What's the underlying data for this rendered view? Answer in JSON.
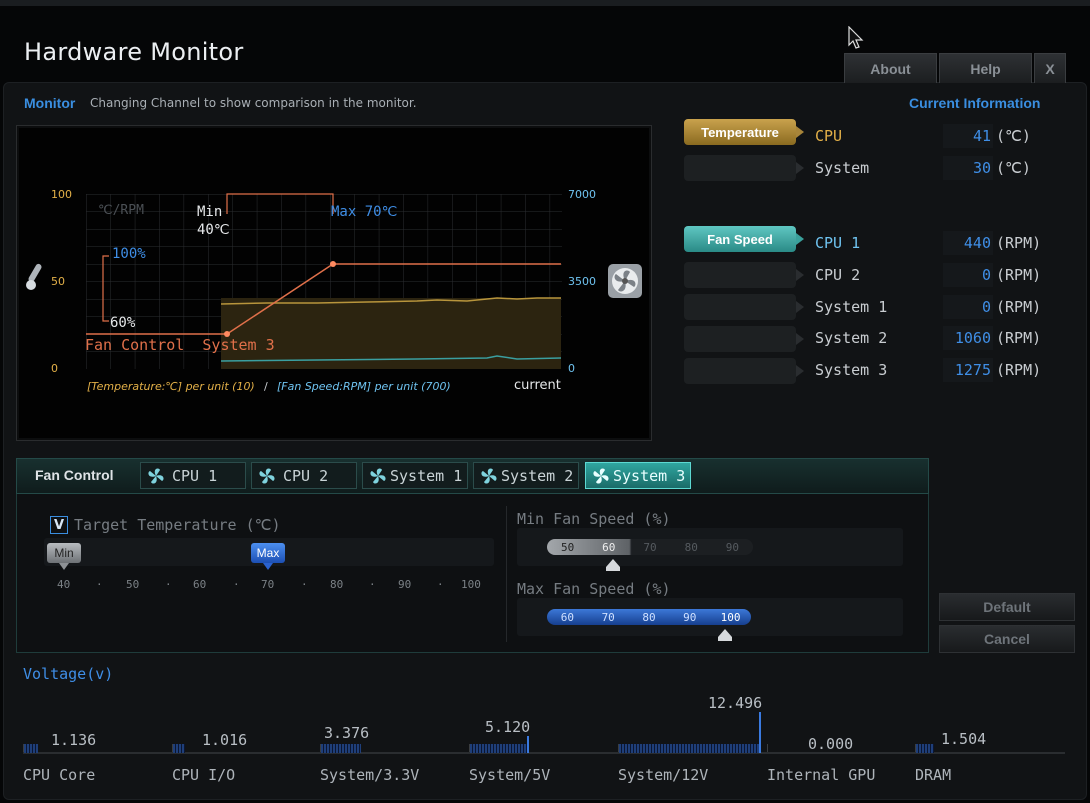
{
  "app": {
    "title": "Hardware Monitor",
    "buttons": {
      "about": "About",
      "help": "Help",
      "close": "X"
    }
  },
  "monitor": {
    "title": "Monitor",
    "description": "Changing Channel to show comparison in the monitor.",
    "current_info_title": "Current Information",
    "graph": {
      "left_axis": [
        "100",
        "50",
        "0"
      ],
      "right_axis": [
        "7000",
        "3500",
        "0"
      ],
      "unit_label": "℃/RPM",
      "min_label": "Min",
      "min_temp": "40℃",
      "max_label": "Max 70℃",
      "pct_high": "100%",
      "pct_low": "60%",
      "channel_label": "Fan Control  System 3",
      "legend_temp": "[Temperature:℃] per unit (10)",
      "legend_sep": "/",
      "legend_fan": "[Fan Speed:RPM] per unit (700)",
      "current_label": "current"
    }
  },
  "current_info": {
    "temperature_tab": "Temperature",
    "fan_speed_tab": "Fan Speed",
    "temperatures": [
      {
        "name": "CPU",
        "value": "41",
        "unit": "(℃)"
      },
      {
        "name": "System",
        "value": "30",
        "unit": "(℃)"
      }
    ],
    "fans": [
      {
        "name": "CPU 1",
        "value": "440",
        "unit": "(RPM)"
      },
      {
        "name": "CPU 2",
        "value": "0",
        "unit": "(RPM)"
      },
      {
        "name": "System 1",
        "value": "0",
        "unit": "(RPM)"
      },
      {
        "name": "System 2",
        "value": "1060",
        "unit": "(RPM)"
      },
      {
        "name": "System 3",
        "value": "1275",
        "unit": "(RPM)"
      }
    ]
  },
  "fan_control": {
    "label": "Fan Control",
    "tabs": [
      "CPU 1",
      "CPU 2",
      "System 1",
      "System 2",
      "System 3"
    ],
    "active_tab": "System 3",
    "target_checkbox": "V",
    "target_label": "Target Temperature (℃)",
    "min_thumb": "Min",
    "max_thumb": "Max",
    "target_ticks": [
      "40",
      "·",
      "50",
      "·",
      "60",
      "·",
      "70",
      "·",
      "80",
      "·",
      "90",
      "·",
      "100"
    ],
    "target_min_value": 40,
    "target_max_value": 70,
    "min_fan_label": "Min Fan Speed (%)",
    "min_fan_options": [
      "50",
      "60",
      "70",
      "80",
      "90"
    ],
    "min_fan_value": "60",
    "max_fan_label": "Max Fan Speed (%)",
    "max_fan_options": [
      "60",
      "70",
      "80",
      "90",
      "100"
    ],
    "max_fan_value": "100",
    "default_button": "Default",
    "cancel_button": "Cancel"
  },
  "voltage": {
    "title": "Voltage(v)",
    "items": [
      {
        "label": "CPU Core",
        "value": "1.136"
      },
      {
        "label": "CPU I/O",
        "value": "1.016"
      },
      {
        "label": "System/3.3V",
        "value": "3.376"
      },
      {
        "label": "System/5V",
        "value": "5.120"
      },
      {
        "label": "System/12V",
        "value": "12.496"
      },
      {
        "label": "Internal GPU",
        "value": "0.000"
      },
      {
        "label": "DRAM",
        "value": "1.504"
      }
    ]
  },
  "colors": {
    "accent_blue": "#3a8ee0",
    "temp_gold": "#e3b048",
    "fan_teal": "#5fc7c2",
    "curve_orange": "#e0704a"
  }
}
